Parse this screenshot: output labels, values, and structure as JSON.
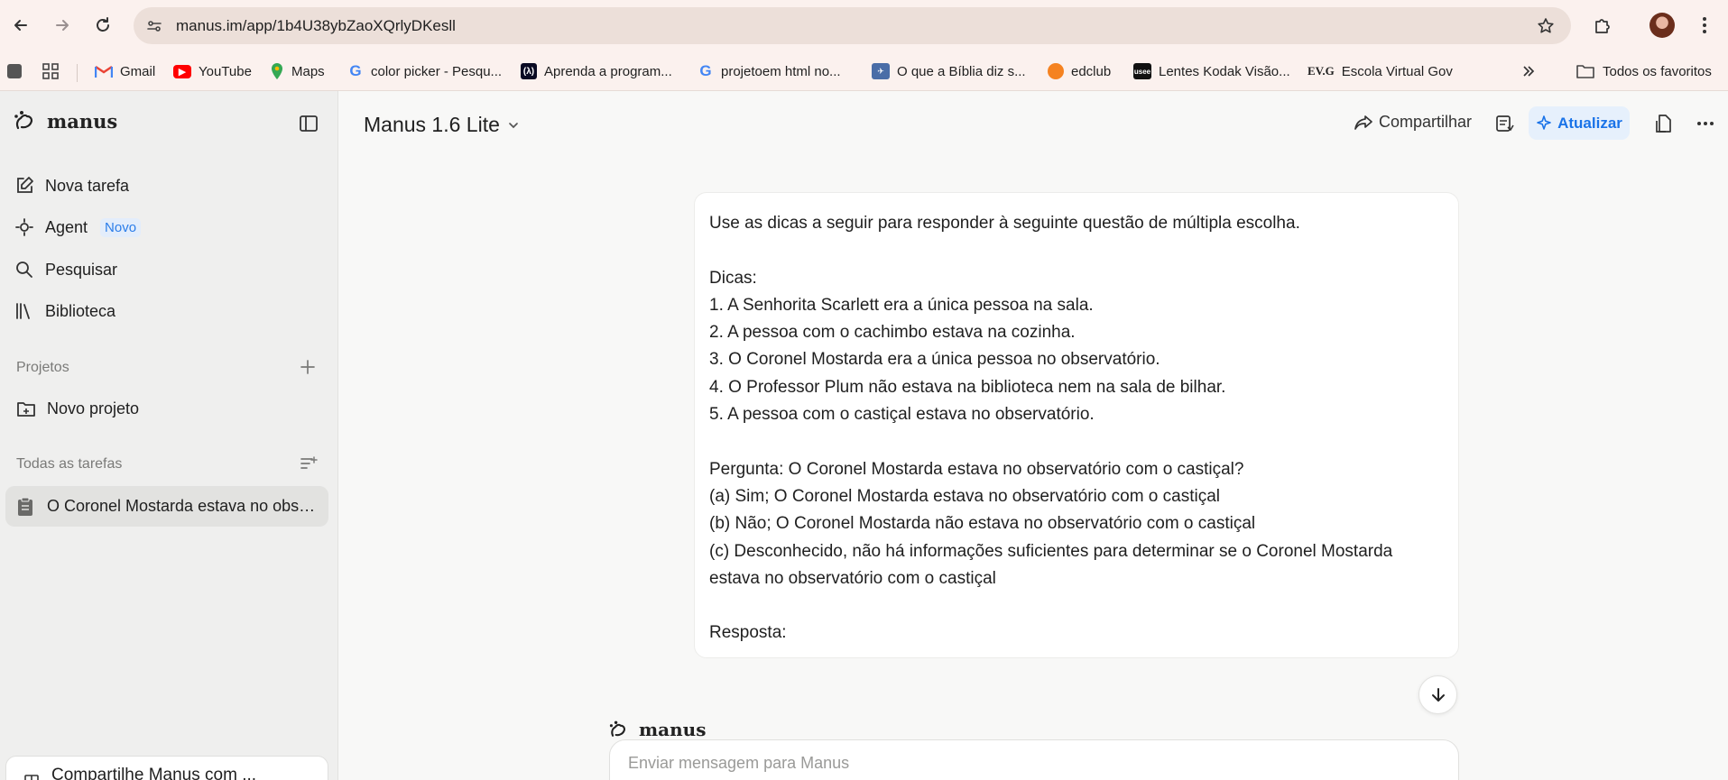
{
  "browser": {
    "url": "manus.im/app/1b4U38ybZaoXQrlyDKesll",
    "bookmarks": [
      {
        "label": "Gmail",
        "icon": "gmail-icon",
        "color": "#ea4335"
      },
      {
        "label": "YouTube",
        "icon": "youtube-icon",
        "color": "#ff0000"
      },
      {
        "label": "Maps",
        "icon": "maps-icon",
        "color": "#34a853"
      },
      {
        "label": "color picker - Pesqu...",
        "icon": "google-icon",
        "color": "#4285f4"
      },
      {
        "label": "Aprenda a program...",
        "icon": "freecodecamp-icon",
        "color": "#0a0a23"
      },
      {
        "label": "projetoem html no...",
        "icon": "google-icon",
        "color": "#4285f4"
      },
      {
        "label": "O que a Bíblia diz s...",
        "icon": "jw-icon",
        "color": "#4a6da7"
      },
      {
        "label": "edclub",
        "icon": "edclub-icon",
        "color": "#f58220"
      },
      {
        "label": "Lentes Kodak Visão...",
        "icon": "usee-icon",
        "color": "#111111"
      },
      {
        "label": "Escola Virtual Gov",
        "icon": "evg-icon",
        "color": "#1f1f1f"
      }
    ],
    "all_bookmarks": "Todos os favoritos",
    "evg_mark": "EV.G",
    "usee_mark": "usee"
  },
  "sidebar": {
    "brand": "manus",
    "items": [
      {
        "label": "Nova tarefa",
        "icon": "edit-icon"
      },
      {
        "label": "Agent",
        "icon": "agent-icon",
        "badge": "Novo"
      },
      {
        "label": "Pesquisar",
        "icon": "search-icon"
      },
      {
        "label": "Biblioteca",
        "icon": "library-icon"
      }
    ],
    "projects_heading": "Projetos",
    "new_project": "Novo projeto",
    "tasks_heading": "Todas as tarefas",
    "tasks": [
      {
        "label": "O Coronel Mostarda estava no observatório com o castiçal?"
      }
    ],
    "share_card": "Compartilhe Manus com ..."
  },
  "header": {
    "model": "Manus 1.6 Lite",
    "share": "Compartilhar",
    "upgrade": "Atualizar"
  },
  "message": {
    "text": "Use as dicas a seguir para responder à seguinte questão de múltipla escolha.\n\nDicas:\n1. A Senhorita Scarlett era a única pessoa na sala.\n2. A pessoa com o cachimbo estava na cozinha.\n3. O Coronel Mostarda era a única pessoa no observatório.\n4. O Professor Plum não estava na biblioteca nem na sala de bilhar.\n5. A pessoa com o castiçal estava no observatório.\n\nPergunta: O Coronel Mostarda estava no observatório com o castiçal?\n(a) Sim; O Coronel Mostarda estava no observatório com o castiçal\n(b) Não; O Coronel Mostarda não estava no observatório com o castiçal\n(c) Desconhecido, não há informações suficientes para determinar se o Coronel Mostarda estava no observatório com o castiçal\n\nResposta:"
  },
  "reply": {
    "brand": "manus"
  },
  "composer": {
    "placeholder": "Enviar mensagem para Manus"
  }
}
